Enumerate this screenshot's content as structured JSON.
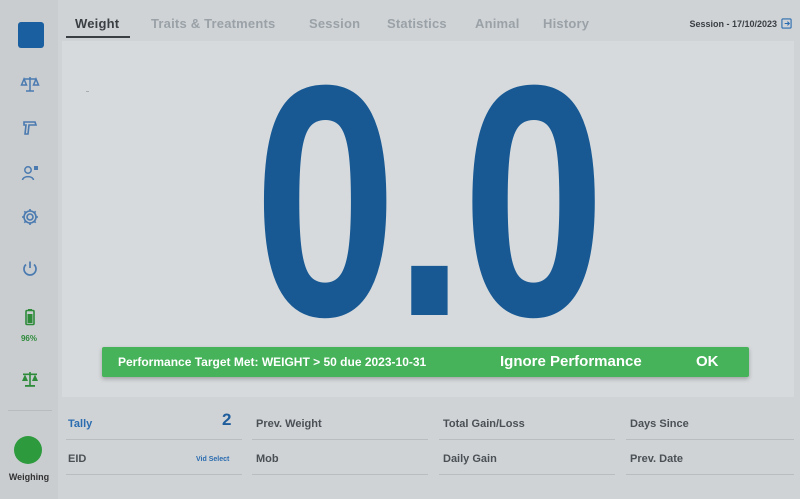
{
  "tabs": [
    {
      "label": "Weight",
      "active": true
    },
    {
      "label": "Traits & Treatments",
      "active": false
    },
    {
      "label": "Session",
      "active": false
    },
    {
      "label": "Statistics",
      "active": false
    },
    {
      "label": "Animal",
      "active": false
    },
    {
      "label": "History",
      "active": false
    }
  ],
  "session": {
    "label": "Session - 17/10/2023"
  },
  "weight_display": {
    "value": "0.0"
  },
  "sidebar": {
    "battery_percent": "96%",
    "status_label": "Weighing",
    "icons": [
      "scale-icon",
      "spray-gun-icon",
      "person-settings-icon",
      "gear-icon",
      "power-icon",
      "battery-icon",
      "scale-alt-icon"
    ]
  },
  "banner": {
    "message": "Performance Target Met:  WEIGHT > 50 due 2023-10-31",
    "ignore_label": "Ignore Performance",
    "ok_label": "OK"
  },
  "info": {
    "tally_label": "Tally",
    "tally_value": "2",
    "eid_label": "EID",
    "vid_select_label": "Vid Select",
    "prev_weight_label": "Prev. Weight",
    "mob_label": "Mob",
    "total_gain_label": "Total Gain/Loss",
    "daily_gain_label": "Daily Gain",
    "days_since_label": "Days Since",
    "prev_date_label": "Prev. Date"
  },
  "colors": {
    "accent_blue": "#185994",
    "banner_green": "#46b35a",
    "status_green": "#2e9a3e"
  }
}
